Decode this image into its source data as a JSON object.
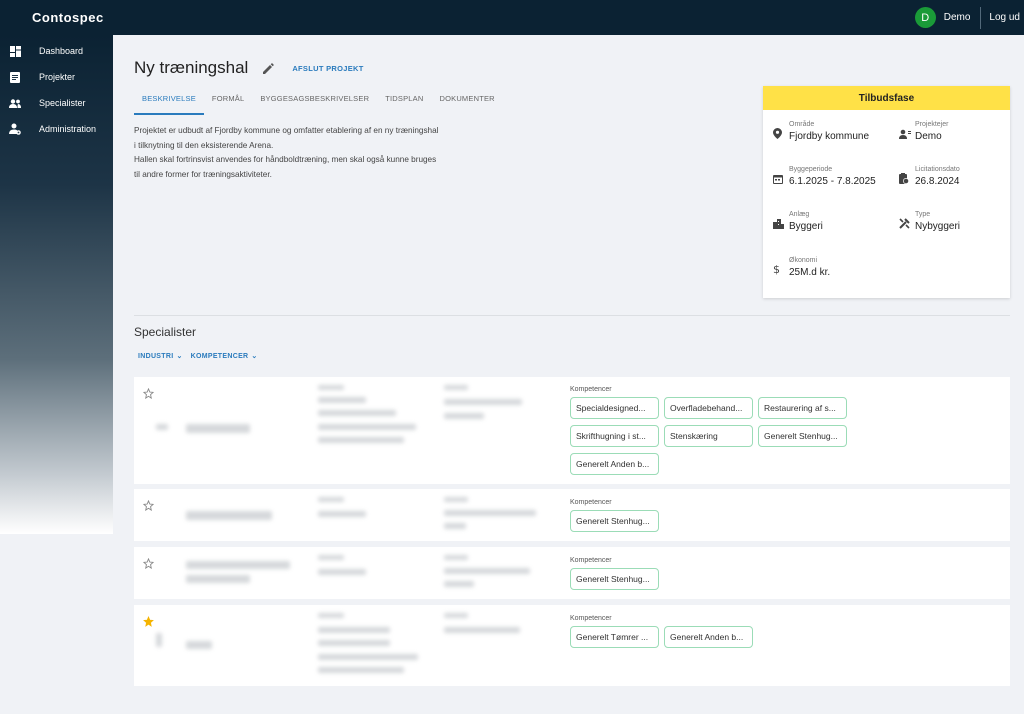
{
  "app": {
    "logo": "Contospec",
    "user_initial": "D",
    "user_name": "Demo",
    "logout": "Log ud"
  },
  "sidebar": {
    "items": [
      {
        "label": "Dashboard",
        "icon": "dashboard-icon"
      },
      {
        "label": "Projekter",
        "icon": "document-icon"
      },
      {
        "label": "Specialister",
        "icon": "people-icon"
      },
      {
        "label": "Administration",
        "icon": "admin-icon"
      }
    ]
  },
  "project": {
    "title": "Ny træningshal",
    "finish_label": "AFSLUT PROJEKT",
    "tabs": [
      "BESKRIVELSE",
      "FORMÅL",
      "BYGGESAGSBESKRIVELSER",
      "TIDSPLAN",
      "DOKUMENTER"
    ],
    "active_tab": 0,
    "description": [
      "Projektet er udbudt af Fjordby kommune og omfatter etablering af en ny træningshal",
      "i tilknytning til den eksisterende Arena.",
      "Hallen skal fortrinsvist anvendes for håndboldtræning, men skal også kunne bruges",
      "til andre former for træningsaktiviteter."
    ]
  },
  "info": {
    "phase": "Tilbudsfase",
    "phase_color": "#ffe147",
    "area_label": "Område",
    "area_value": "Fjordby kommune",
    "owner_label": "Projektejer",
    "owner_value": "Demo",
    "period_label": "Byggeperiode",
    "period_value": "6.1.2025 - 7.8.2025",
    "tender_label": "Licitationsdato",
    "tender_value": "26.8.2024",
    "facility_label": "Anlæg",
    "facility_value": "Byggeri",
    "type_label": "Type",
    "type_value": "Nybyggeri",
    "economy_label": "Økonomi",
    "economy_value": "25M.d kr."
  },
  "specialists": {
    "title": "Specialister",
    "filters": [
      "INDUSTRI",
      "KOMPETENCER"
    ],
    "competence_label": "Kompetencer",
    "cards": [
      {
        "starred": false,
        "chips": [
          "Specialdesigned...",
          "Overfladebehand...",
          "Restaurering af s...",
          "Skrifthugning i st...",
          "Stenskæring",
          "Generelt Stenhug...",
          "Generelt Anden b..."
        ]
      },
      {
        "starred": false,
        "chips": [
          "Generelt Stenhug..."
        ]
      },
      {
        "starred": false,
        "chips": [
          "Generelt Stenhug..."
        ]
      },
      {
        "starred": true,
        "chips": [
          "Generelt Tømrer ...",
          "Generelt Anden b..."
        ]
      }
    ]
  },
  "colors": {
    "accent": "#2a7bbd",
    "star_active": "#f5b400",
    "chip_border": "#9bdcb7",
    "topbar": "#0b2233"
  }
}
